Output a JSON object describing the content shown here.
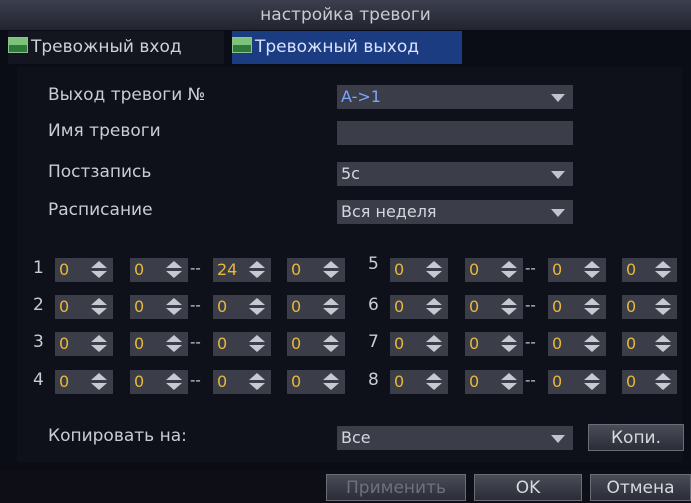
{
  "window_title": "настройка тревоги",
  "tabs": {
    "input_label": "Тревожный вход",
    "output_label": "Тревожный выход"
  },
  "form": {
    "alarm_out_label": "Выход тревоги №",
    "alarm_out_value": "A->1",
    "alarm_name_label": "Имя тревоги",
    "alarm_name_value": "",
    "postrecord_label": "Постзапись",
    "postrecord_value": "5c",
    "schedule_label": "Расписание",
    "schedule_value": "Вся неделя",
    "copy_to_label": "Копировать на:",
    "copy_to_value": "Все"
  },
  "schedule_rows": {
    "r1": {
      "num": "1",
      "v": [
        "0",
        "0",
        "24",
        "0"
      ]
    },
    "r2": {
      "num": "2",
      "v": [
        "0",
        "0",
        "0",
        "0"
      ]
    },
    "r3": {
      "num": "3",
      "v": [
        "0",
        "0",
        "0",
        "0"
      ]
    },
    "r4": {
      "num": "4",
      "v": [
        "0",
        "0",
        "0",
        "0"
      ]
    },
    "r5": {
      "num": "5",
      "v": [
        "0",
        "0",
        "0",
        "0"
      ]
    },
    "r6": {
      "num": "6",
      "v": [
        "0",
        "0",
        "0",
        "0"
      ]
    },
    "r7": {
      "num": "7",
      "v": [
        "0",
        "0",
        "0",
        "0"
      ]
    },
    "r8": {
      "num": "8",
      "v": [
        "0",
        "0",
        "0",
        "0"
      ]
    }
  },
  "buttons": {
    "copy_label": "Копи.",
    "apply_label": "Применить",
    "ok_label": "OK",
    "cancel_label": "Отмена"
  },
  "colors": {
    "accent_tab": "#1c3c82",
    "value_orange": "#e8b83a",
    "value_blue": "#7fa4ff"
  }
}
